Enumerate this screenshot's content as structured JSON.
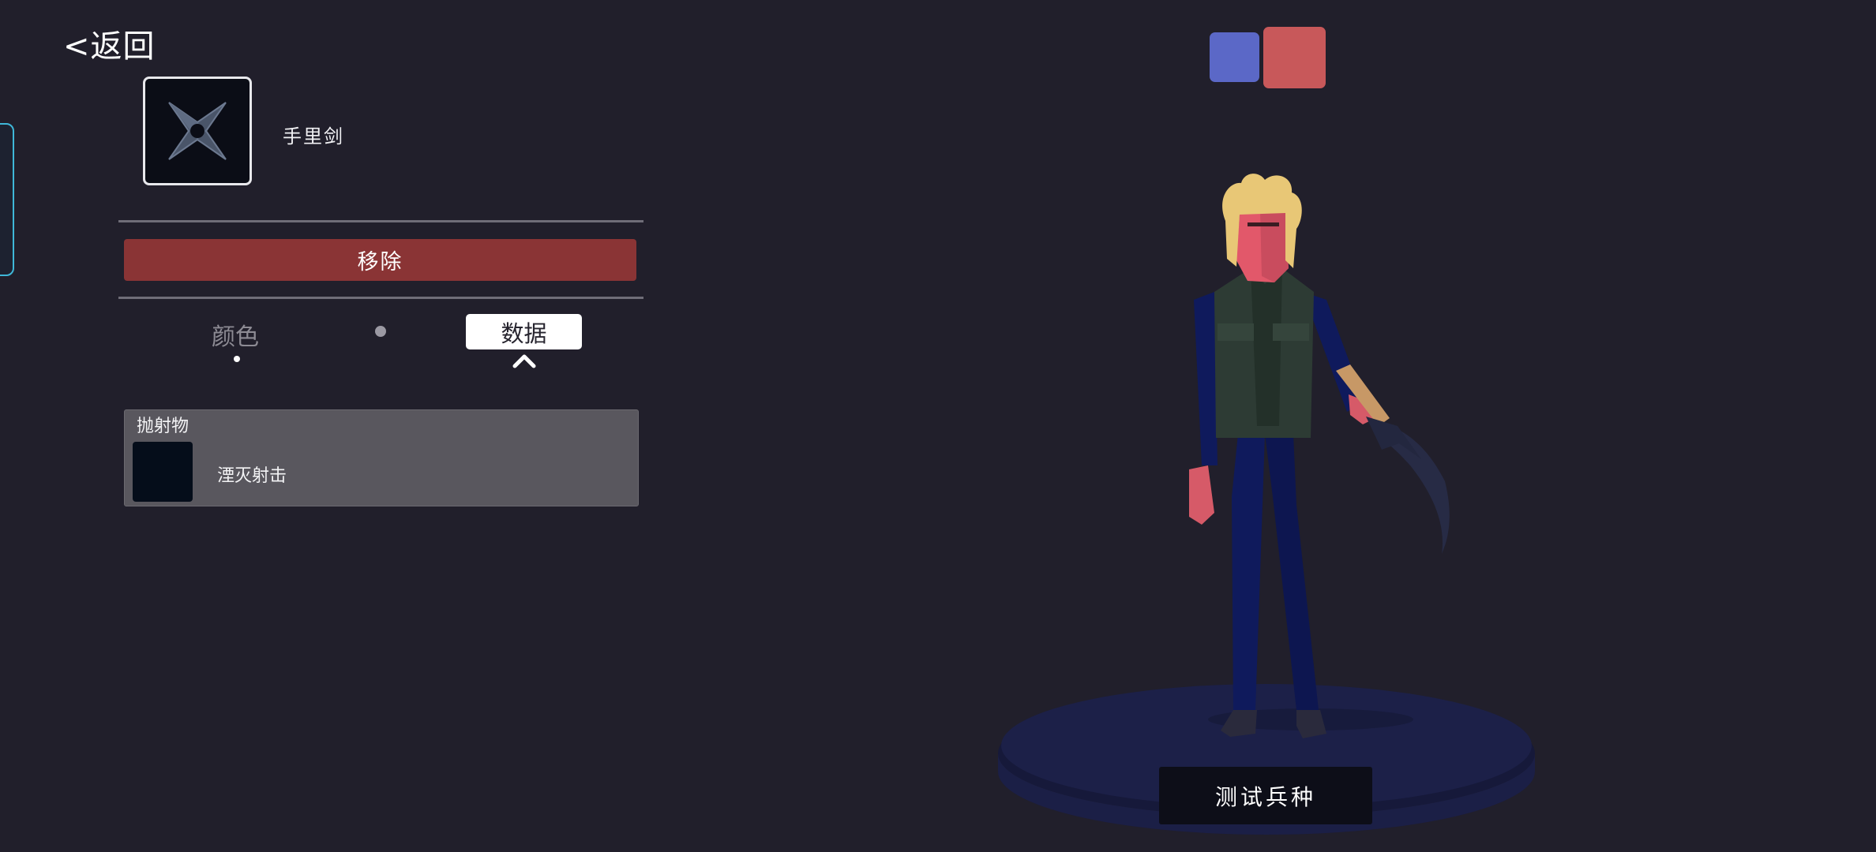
{
  "header": {
    "back_label": "<返回"
  },
  "weapon": {
    "icon": "shuriken-icon",
    "name": "手里剑",
    "remove_label": "移除"
  },
  "tabs": {
    "color_label": "颜色",
    "data_label": "数据",
    "active": "data"
  },
  "projectile_panel": {
    "title": "抛射物",
    "item_icon": "projectile-icon",
    "item_name": "湮灭射击"
  },
  "teams": {
    "blue_color": "#5b68c7",
    "red_color": "#c8585a",
    "selected": "red"
  },
  "preview": {
    "character": "unit-preview-figure",
    "test_label": "测试兵种"
  },
  "colors": {
    "background": "#211f2b",
    "remove_button": "#8a3435",
    "panel": "#59575e"
  }
}
